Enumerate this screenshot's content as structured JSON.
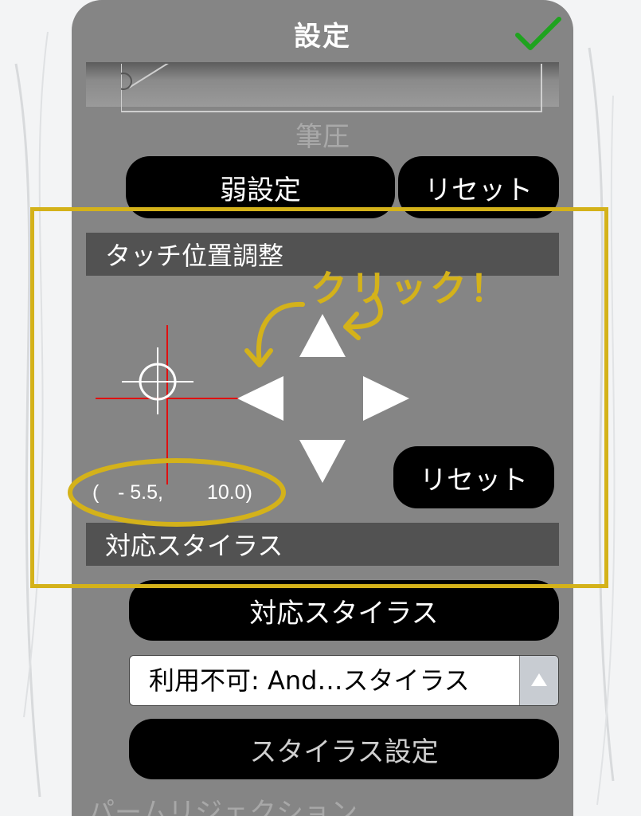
{
  "dialog": {
    "title": "設定",
    "confirm_icon": "checkmark-icon"
  },
  "pressure": {
    "label": "筆圧",
    "weak_button": "弱設定",
    "reset_button": "リセット"
  },
  "touch_adjust": {
    "header": "タッチ位置調整",
    "offset_x": "- 5.5,",
    "offset_y": "10.0)",
    "open_paren": "(",
    "reset_button": "リセット",
    "arrows": [
      "arrow-up-icon",
      "arrow-left-icon",
      "arrow-right-icon",
      "arrow-down-icon"
    ]
  },
  "stylus": {
    "header": "対応スタイラス",
    "stylus_button": "対応スタイラス",
    "selected_option": "利用不可: And…スタイラス",
    "settings_button": "スタイラス設定"
  },
  "palm": {
    "label": "パームリジェクション"
  },
  "annotation": {
    "text": "クリック！",
    "color": "#d4b21a"
  },
  "colors": {
    "panel": "#858585",
    "section_bar": "#525252",
    "crosshair_red": "#e01010",
    "confirm_green": "#1fa31f"
  }
}
